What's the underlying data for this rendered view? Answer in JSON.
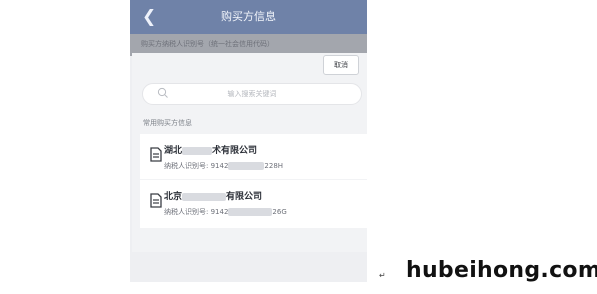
{
  "nav": {
    "title": "购买方信息",
    "back_icon": "chevron-left-icon",
    "behind_text": "购买方纳税人识别号（统一社会信用代码）"
  },
  "sheet": {
    "cancel_label": "取消",
    "search_placeholder": "输入搜索关键词",
    "section_title": "常用购买方信息"
  },
  "buyers": [
    {
      "name_prefix": "湖北",
      "name_suffix": "术有限公司",
      "tax_label": "纳税人识别号: 9142",
      "tax_tail": "228H"
    },
    {
      "name_prefix": "北京",
      "name_suffix": "有限公司",
      "tax_label": "纳税人识别号: 9142",
      "tax_tail": "26G"
    }
  ],
  "watermark": "hubeihong.com",
  "colors": {
    "navbar": "#6f82a8",
    "background": "#eeeff2",
    "card": "#ffffff"
  }
}
